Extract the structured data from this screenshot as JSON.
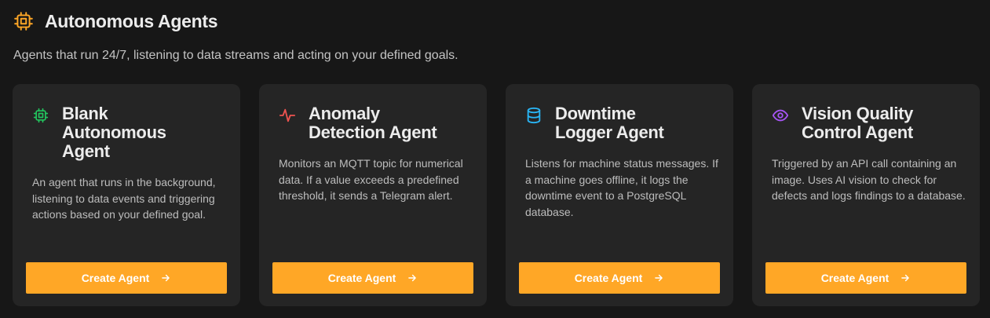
{
  "section": {
    "title": "Autonomous Agents",
    "title_icon": "cpu-chip-icon",
    "subtitle": "Agents that run 24/7, listening to data streams and acting on your defined goals.",
    "accent_color": "#ffa726"
  },
  "cards": [
    {
      "icon": "cpu-chip-icon",
      "icon_color": "#22c55e",
      "title_line1": "Blank",
      "title_line2": "Autonomous",
      "title_line3": "Agent",
      "description": "An agent that runs in the background, listening to data events and triggering actions based on your defined goal.",
      "button_label": "Create Agent"
    },
    {
      "icon": "activity-pulse-icon",
      "icon_color": "#ef5350",
      "title_line1": "Anomaly",
      "title_line2": "Detection Agent",
      "description": "Monitors an MQTT topic for numerical data. If a value exceeds a predefined threshold, it sends a Telegram alert.",
      "button_label": "Create Agent"
    },
    {
      "icon": "database-icon",
      "icon_color": "#29b6f6",
      "title_line1": "Downtime",
      "title_line2": "Logger Agent",
      "description": "Listens for machine status messages. If a machine goes offline, it logs the downtime event to a PostgreSQL database.",
      "button_label": "Create Agent"
    },
    {
      "icon": "eye-icon",
      "icon_color": "#a855f7",
      "title_line1": "Vision Quality",
      "title_line2": "Control Agent",
      "description": "Triggered by an API call containing an image. Uses AI vision to check for defects and logs findings to a database.",
      "button_label": "Create Agent"
    }
  ]
}
